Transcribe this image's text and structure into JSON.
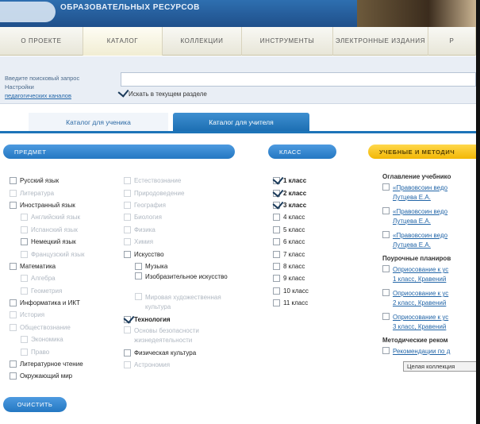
{
  "header": {
    "title": "ОБРАЗОВАТЕЛЬНЫХ РЕСУРСОВ"
  },
  "nav": [
    {
      "label": "О ПРОЕКТЕ",
      "width": 105
    },
    {
      "label": "КАТАЛОГ",
      "width": 100,
      "active": true
    },
    {
      "label": "КОЛЛЕКЦИИ",
      "width": 100
    },
    {
      "label": "ИНСТРУМЕНТЫ",
      "width": 115
    },
    {
      "label": "ЭЛЕКТРОННЫЕ ИЗДАНИЯ",
      "width": 120
    },
    {
      "label": "Р",
      "width": 60
    }
  ],
  "search": {
    "label_lines": [
      "Введите поисковый запрос",
      "Настройки"
    ],
    "label_link": "педагогических каналов",
    "input_value": "",
    "in_section_label": "Искать в текущем разделе",
    "in_section_checked": true
  },
  "tabs": {
    "students": "Каталог для ученика",
    "teachers": "Каталог для учителя"
  },
  "sections": {
    "subject": "ПРЕДМЕТ",
    "grade": "КЛАСС",
    "materials": "УЧЕБНЫЕ И МЕТОДИЧ"
  },
  "subjects_col1": [
    {
      "label": "Русский язык",
      "checked": false,
      "faded": false,
      "indent": false
    },
    {
      "label": "Литература",
      "checked": false,
      "faded": true,
      "indent": false
    },
    {
      "label": "Иностранный язык",
      "checked": false,
      "faded": false,
      "indent": false
    },
    {
      "label": "Английский язык",
      "checked": false,
      "faded": true,
      "indent": true
    },
    {
      "label": "Испанский язык",
      "checked": false,
      "faded": true,
      "indent": true
    },
    {
      "label": "Немецкий язык",
      "checked": false,
      "faded": false,
      "indent": true
    },
    {
      "label": "Французский язык",
      "checked": false,
      "faded": true,
      "indent": true
    },
    {
      "label": "Математика",
      "checked": false,
      "faded": false,
      "indent": false
    },
    {
      "label": "Алгебра",
      "checked": false,
      "faded": true,
      "indent": true
    },
    {
      "label": "Геометрия",
      "checked": false,
      "faded": true,
      "indent": true
    },
    {
      "label": "Информатика и ИКТ",
      "checked": false,
      "faded": false,
      "indent": false
    },
    {
      "label": "История",
      "checked": false,
      "faded": true,
      "indent": false
    },
    {
      "label": "Обществознание",
      "checked": false,
      "faded": true,
      "indent": false
    },
    {
      "label": "Экономика",
      "checked": false,
      "faded": true,
      "indent": true
    },
    {
      "label": "Право",
      "checked": false,
      "faded": true,
      "indent": true
    },
    {
      "label": "Литературное чтение",
      "checked": false,
      "faded": false,
      "indent": false
    },
    {
      "label": "Окружающий мир",
      "checked": false,
      "faded": false,
      "indent": false
    }
  ],
  "subjects_col2": [
    {
      "label": "Естествознание",
      "checked": false,
      "faded": true,
      "indent": false,
      "wrap": false
    },
    {
      "label": "Природоведение",
      "checked": false,
      "faded": true,
      "indent": false,
      "wrap": false
    },
    {
      "label": "География",
      "checked": false,
      "faded": true,
      "indent": false,
      "wrap": false
    },
    {
      "label": "Биология",
      "checked": false,
      "faded": true,
      "indent": false,
      "wrap": false
    },
    {
      "label": "Физика",
      "checked": false,
      "faded": true,
      "indent": false,
      "wrap": false
    },
    {
      "label": "Химия",
      "checked": false,
      "faded": true,
      "indent": false,
      "wrap": false
    },
    {
      "label": "Искусство",
      "checked": false,
      "faded": false,
      "indent": false,
      "wrap": false
    },
    {
      "label": "Музыка",
      "checked": false,
      "faded": false,
      "indent": true,
      "wrap": false
    },
    {
      "label": "Изобразительное искусство",
      "checked": false,
      "faded": false,
      "indent": true,
      "wrap": true
    },
    {
      "label": "Мировая художественная культура",
      "checked": false,
      "faded": true,
      "indent": true,
      "wrap": true
    },
    {
      "label": "Технология",
      "checked": true,
      "faded": false,
      "indent": false,
      "wrap": false,
      "bold": true
    },
    {
      "label": "Основы безопасности жизнедеятельности",
      "checked": false,
      "faded": true,
      "indent": false,
      "wrap": true
    },
    {
      "label": "Физическая культура",
      "checked": false,
      "faded": false,
      "indent": false,
      "wrap": false
    },
    {
      "label": "Астрономия",
      "checked": false,
      "faded": true,
      "indent": false,
      "wrap": false
    }
  ],
  "grades": [
    {
      "label": "1 класс",
      "checked": true
    },
    {
      "label": "2 класс",
      "checked": true
    },
    {
      "label": "3 класс",
      "checked": true
    },
    {
      "label": "4 класс",
      "checked": false
    },
    {
      "label": "5 класс",
      "checked": false
    },
    {
      "label": "6 класс",
      "checked": false
    },
    {
      "label": "7 класс",
      "checked": false
    },
    {
      "label": "8 класс",
      "checked": false
    },
    {
      "label": "9 класс",
      "checked": false
    },
    {
      "label": "10 класс",
      "checked": false
    },
    {
      "label": "11 класс",
      "checked": false
    }
  ],
  "materials": {
    "group1_title": "Оглавление учебнико",
    "group1_items": [
      {
        "line1": "«Правовсоин ведо",
        "line2": "Лутцева Е.А."
      },
      {
        "line1": "«Правовсоин ведо",
        "line2": "Лутцева Е.А."
      },
      {
        "line1": "«Правовсоин ведо",
        "line2": "Лутцева Е.А."
      }
    ],
    "group2_title": "Поурочные планиров",
    "group2_items": [
      {
        "line1": "Оприосование к ус",
        "line2": "1 класс, Кравений"
      },
      {
        "line1": "Оприосование к ус",
        "line2": "2 класс, Кравений"
      },
      {
        "line1": "Оприосование к ус",
        "line2": "3 класс, Кравений"
      }
    ],
    "group3_title": "Методические реком",
    "group3_items": [
      {
        "line1": "Рекомендации по д",
        "line2": ""
      }
    ],
    "box_label": "Целая коллекция"
  },
  "clear_button": "ОЧИСТИТЬ",
  "colors": {
    "accent_blue": "#2478c2",
    "accent_yellow": "#f2b705"
  }
}
